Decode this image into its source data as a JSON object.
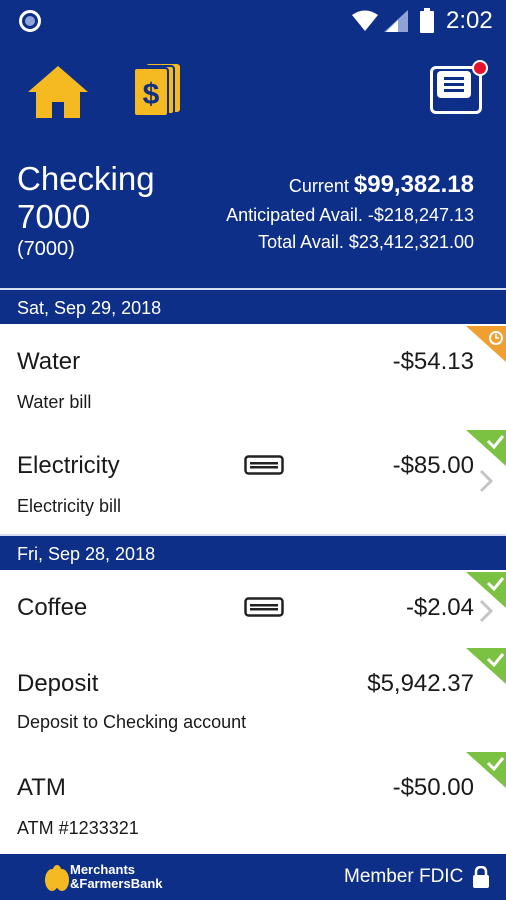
{
  "status_bar": {
    "time": "2:02"
  },
  "account": {
    "name": "Checking 7000",
    "number": "(7000)",
    "current_label": "Current",
    "current_value": "$99,382.18",
    "anticipated": "Anticipated Avail. -$218,247.13",
    "total": "Total Avail. $23,412,321.00"
  },
  "groups": [
    {
      "date": "Sat, Sep 29, 2018",
      "transactions": [
        {
          "title": "Water",
          "amount": "-$54.13",
          "description": "Water bill",
          "status": "pending",
          "status_color": "#f0a030"
        },
        {
          "title": "Electricity",
          "amount": "-$85.00",
          "description": "Electricity bill",
          "status": "cleared",
          "status_color": "#7cc242"
        }
      ]
    },
    {
      "date": "Fri, Sep 28, 2018",
      "transactions": [
        {
          "title": "Coffee",
          "amount": "-$2.04",
          "description": "",
          "status": "cleared",
          "status_color": "#7cc242"
        },
        {
          "title": "Deposit",
          "amount": "$5,942.37",
          "description": "Deposit to Checking account",
          "status": "cleared",
          "status_color": "#7cc242"
        },
        {
          "title": "ATM",
          "amount": "-$50.00",
          "description": "ATM #1233321",
          "status": "cleared",
          "status_color": "#7cc242"
        }
      ]
    }
  ],
  "footer": {
    "bank_line1": "Merchants",
    "bank_line2": "&FarmersBank",
    "fdic": "Member FDIC"
  },
  "icons": [
    "home-icon",
    "deposit-check-icon",
    "menu-icon",
    "card-icon",
    "chevron-right-icon",
    "lock-icon",
    "wifi-icon",
    "signal-icon",
    "battery-icon"
  ],
  "colors": {
    "header_bg": "#0d2f87",
    "icon_yellow": "#f5b921",
    "cleared_green": "#7cc242",
    "pending_orange": "#f0a030",
    "badge_red": "#e8112d"
  }
}
